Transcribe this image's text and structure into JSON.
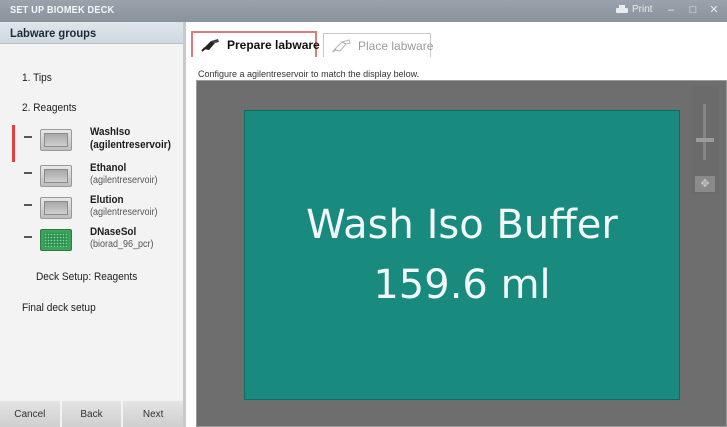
{
  "window": {
    "title": "SET UP BIOMEK DECK",
    "print_label": "Print",
    "minimize_glyph": "–",
    "maximize_glyph": "□",
    "close_glyph": "✕"
  },
  "sidebar": {
    "header": "Labware groups",
    "groups": [
      {
        "label": "1. Tips"
      },
      {
        "label": "2. Reagents"
      }
    ],
    "reagents": [
      {
        "name": "WashIso",
        "type": "(agilentreservoir)",
        "icon": "reservoir-icon",
        "active": true
      },
      {
        "name": "Ethanol",
        "type": "(agilentreservoir)",
        "icon": "reservoir-icon",
        "active": false
      },
      {
        "name": "Elution",
        "type": "(agilentreservoir)",
        "icon": "reservoir-icon",
        "active": false
      },
      {
        "name": "DNaseSol",
        "type": "(biorad_96_pcr)",
        "icon": "plate-96-icon",
        "active": false
      }
    ],
    "deck_setup_reagents": "Deck Setup: Reagents",
    "final_deck_setup": "Final deck setup",
    "buttons": {
      "cancel": "Cancel",
      "back": "Back",
      "next": "Next"
    },
    "active_color": "#e2403e"
  },
  "tabs": [
    {
      "label": "Prepare labware",
      "icon": "pipette-hand-icon",
      "active": true
    },
    {
      "label": "Place labware",
      "icon": "pipette-hand-icon",
      "active": false
    }
  ],
  "main": {
    "instructions": "Configure a agilentreservoir to match the display below.",
    "labware_display": {
      "name": "Wash Iso Buffer",
      "volume": "159.6 ml",
      "color": "#188a7e"
    },
    "pan_glyph": "✥"
  }
}
